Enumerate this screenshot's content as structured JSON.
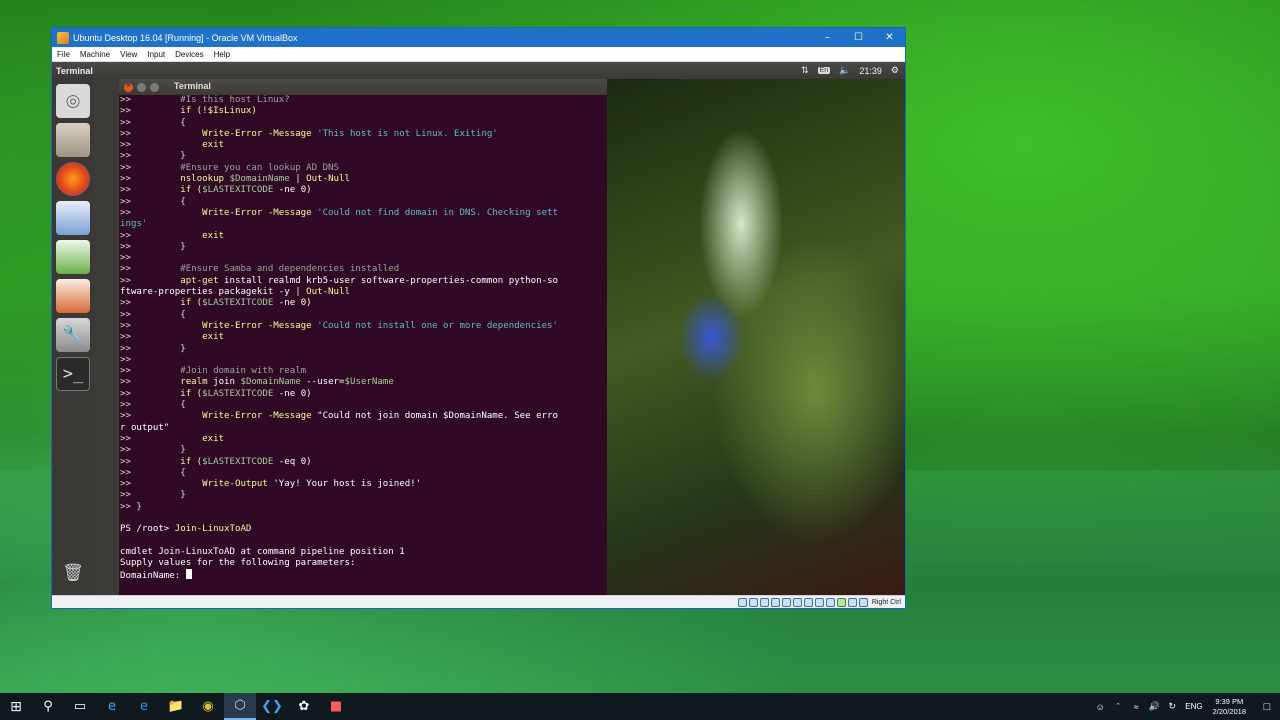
{
  "vbox": {
    "title": "Ubuntu Desktop 16.04 [Running] - Oracle VM VirtualBox",
    "menu": [
      "File",
      "Machine",
      "View",
      "Input",
      "Devices",
      "Help"
    ],
    "host_key": "Right Ctrl"
  },
  "ubuntu": {
    "top_title": "Terminal",
    "keyboard": "En",
    "time": "21:39",
    "terminal_title": "Terminal"
  },
  "terminal": {
    "lines": [
      [
        {
          "t": ">>         ",
          "c": "p"
        },
        {
          "t": "#Is this host Linux?",
          "c": "cm"
        }
      ],
      [
        {
          "t": ">>         ",
          "c": "p"
        },
        {
          "t": "if (!$IsLinux)",
          "c": "kw"
        }
      ],
      [
        {
          "t": ">>         {",
          "c": "p"
        }
      ],
      [
        {
          "t": ">>             ",
          "c": "p"
        },
        {
          "t": "Write-Error -Message ",
          "c": "kw"
        },
        {
          "t": "'This host is not Linux. Exiting'",
          "c": "str"
        }
      ],
      [
        {
          "t": ">>             ",
          "c": "p"
        },
        {
          "t": "exit",
          "c": "kw"
        }
      ],
      [
        {
          "t": ">>         }",
          "c": "p"
        }
      ],
      [
        {
          "t": ">>         ",
          "c": "p"
        },
        {
          "t": "#Ensure you can lookup AD DNS",
          "c": "cm"
        }
      ],
      [
        {
          "t": ">>         ",
          "c": "p"
        },
        {
          "t": "nslookup ",
          "c": "kw"
        },
        {
          "t": "$DomainName",
          "c": "var"
        },
        {
          "t": " | Out-Null",
          "c": "kw"
        }
      ],
      [
        {
          "t": ">>         ",
          "c": "p"
        },
        {
          "t": "if (",
          "c": "kw"
        },
        {
          "t": "$LASTEXITCODE",
          "c": "var"
        },
        {
          "t": " -ne 0)",
          "c": "w"
        }
      ],
      [
        {
          "t": ">>         {",
          "c": "p"
        }
      ],
      [
        {
          "t": ">>             ",
          "c": "p"
        },
        {
          "t": "Write-Error -Message ",
          "c": "kw"
        },
        {
          "t": "'Could not find domain in DNS. Checking sett",
          "c": "str"
        }
      ],
      [
        {
          "t": "ings'",
          "c": "str"
        }
      ],
      [
        {
          "t": ">>             ",
          "c": "p"
        },
        {
          "t": "exit",
          "c": "kw"
        }
      ],
      [
        {
          "t": ">>         }",
          "c": "p"
        }
      ],
      [
        {
          "t": ">>",
          "c": "p"
        }
      ],
      [
        {
          "t": ">>         ",
          "c": "p"
        },
        {
          "t": "#Ensure Samba and dependencies installed",
          "c": "cm"
        }
      ],
      [
        {
          "t": ">>         ",
          "c": "p"
        },
        {
          "t": "apt-get ",
          "c": "kw"
        },
        {
          "t": "install realmd krb5-user software-properties-common python-so",
          "c": "w"
        }
      ],
      [
        {
          "t": "ftware-properties packagekit -y ",
          "c": "w"
        },
        {
          "t": "| Out-Null",
          "c": "kw"
        }
      ],
      [
        {
          "t": ">>         ",
          "c": "p"
        },
        {
          "t": "if (",
          "c": "kw"
        },
        {
          "t": "$LASTEXITCODE",
          "c": "var"
        },
        {
          "t": " -ne 0)",
          "c": "w"
        }
      ],
      [
        {
          "t": ">>         {",
          "c": "p"
        }
      ],
      [
        {
          "t": ">>             ",
          "c": "p"
        },
        {
          "t": "Write-Error -Message ",
          "c": "kw"
        },
        {
          "t": "'Could not install one or more dependencies'",
          "c": "str"
        }
      ],
      [
        {
          "t": ">>             ",
          "c": "p"
        },
        {
          "t": "exit",
          "c": "kw"
        }
      ],
      [
        {
          "t": ">>         }",
          "c": "p"
        }
      ],
      [
        {
          "t": ">>",
          "c": "p"
        }
      ],
      [
        {
          "t": ">>         ",
          "c": "p"
        },
        {
          "t": "#Join domain with realm",
          "c": "cm"
        }
      ],
      [
        {
          "t": ">>         ",
          "c": "p"
        },
        {
          "t": "realm ",
          "c": "kw"
        },
        {
          "t": "join ",
          "c": "w"
        },
        {
          "t": "$DomainName",
          "c": "var"
        },
        {
          "t": " --user=",
          "c": "w"
        },
        {
          "t": "$UserName",
          "c": "var"
        }
      ],
      [
        {
          "t": ">>         ",
          "c": "p"
        },
        {
          "t": "if (",
          "c": "kw"
        },
        {
          "t": "$LASTEXITCODE",
          "c": "var"
        },
        {
          "t": " -ne 0)",
          "c": "w"
        }
      ],
      [
        {
          "t": ">>         {",
          "c": "p"
        }
      ],
      [
        {
          "t": ">>             ",
          "c": "p"
        },
        {
          "t": "Write-Error -Message ",
          "c": "kw"
        },
        {
          "t": "\"Could not join domain $DomainName. See erro",
          "c": "w"
        }
      ],
      [
        {
          "t": "r output\"",
          "c": "w"
        }
      ],
      [
        {
          "t": ">>             ",
          "c": "p"
        },
        {
          "t": "exit",
          "c": "kw"
        }
      ],
      [
        {
          "t": ">>         }",
          "c": "p"
        }
      ],
      [
        {
          "t": ">>         ",
          "c": "p"
        },
        {
          "t": "if (",
          "c": "kw"
        },
        {
          "t": "$LASTEXITCODE",
          "c": "var"
        },
        {
          "t": " -eq 0)",
          "c": "w"
        }
      ],
      [
        {
          "t": ">>         {",
          "c": "p"
        }
      ],
      [
        {
          "t": ">>             ",
          "c": "p"
        },
        {
          "t": "Write-Output ",
          "c": "kw"
        },
        {
          "t": "'Yay! Your host is joined!'",
          "c": "w"
        }
      ],
      [
        {
          "t": ">>         }",
          "c": "p"
        }
      ],
      [
        {
          "t": ">> }",
          "c": "p"
        }
      ],
      [
        {
          "t": "",
          "c": "p"
        }
      ],
      [
        {
          "t": "PS /root> ",
          "c": "w"
        },
        {
          "t": "Join-LinuxToAD",
          "c": "kw"
        }
      ],
      [
        {
          "t": "",
          "c": "p"
        }
      ],
      [
        {
          "t": "cmdlet Join-LinuxToAD at command pipeline position 1",
          "c": "w"
        }
      ],
      [
        {
          "t": "Supply values for the following parameters:",
          "c": "w"
        }
      ],
      [
        {
          "t": "DomainName: ",
          "c": "w"
        }
      ]
    ]
  },
  "taskbar": {
    "language": "ENG",
    "time": "9:39 PM",
    "date": "2/20/2018"
  }
}
